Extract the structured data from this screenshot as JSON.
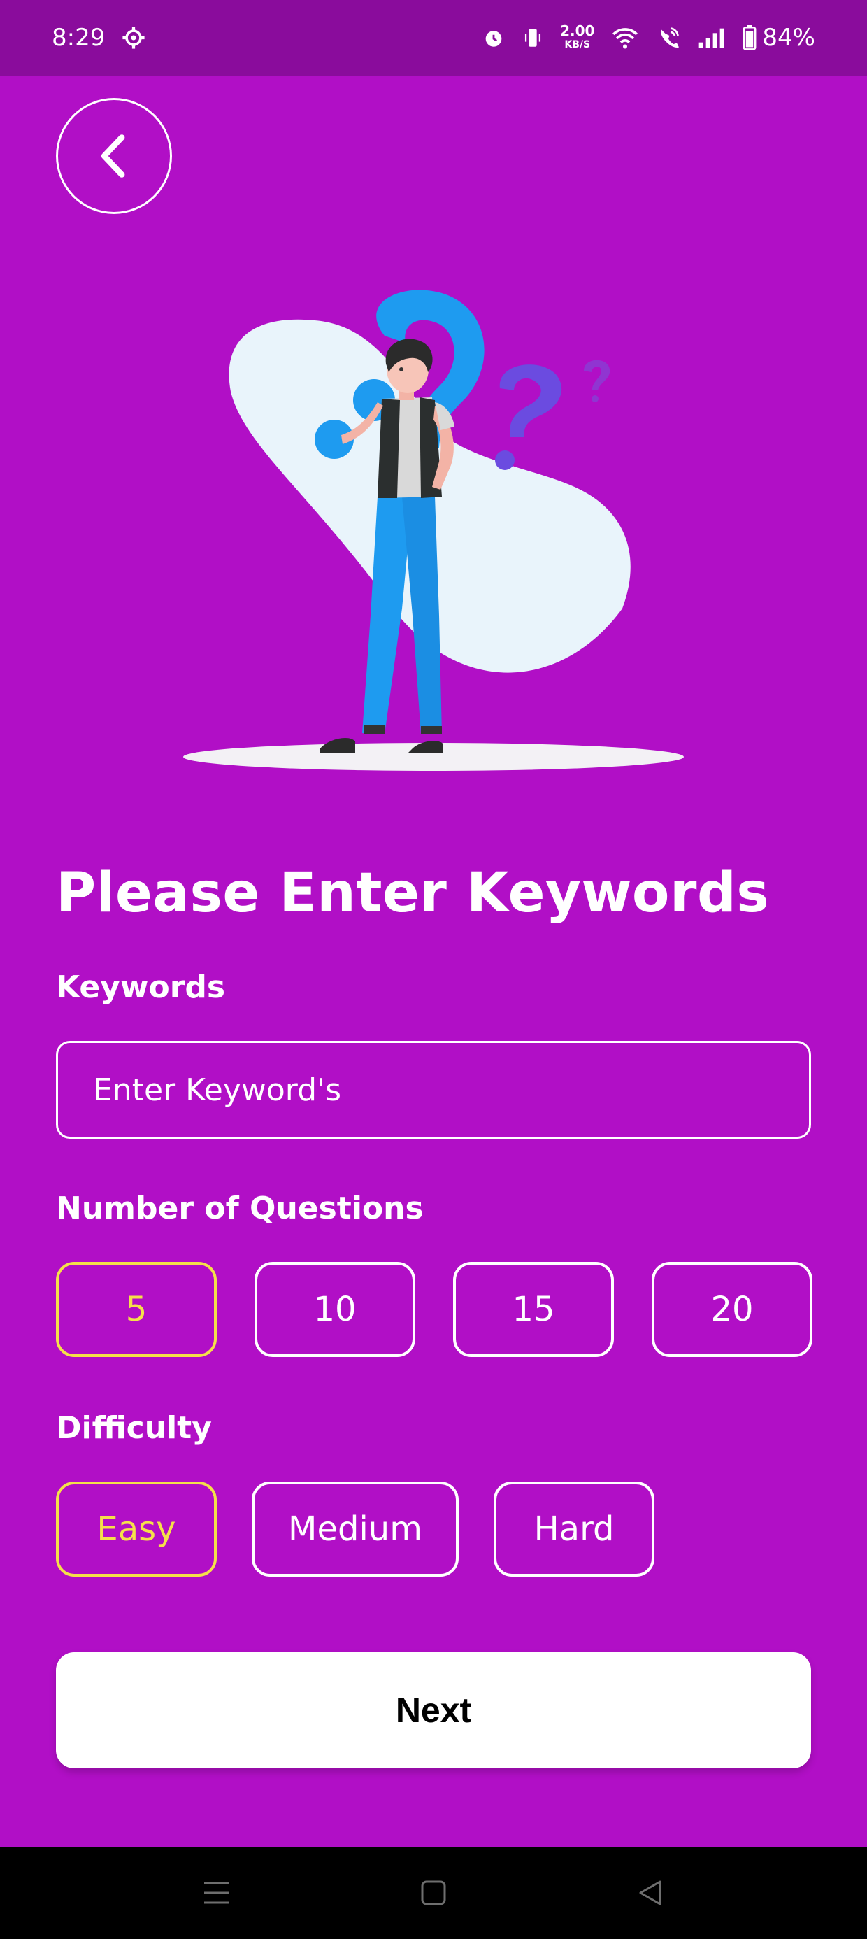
{
  "status_bar": {
    "time": "8:29",
    "net_speed_value": "2.00",
    "net_speed_unit": "KB/S",
    "battery": "84%",
    "icons": [
      "settings-icon",
      "alarm-icon",
      "vibrate-icon",
      "wifi-icon",
      "wifi-calling-icon",
      "signal-icon",
      "battery-icon"
    ]
  },
  "header": {
    "back_icon": "chevron-left-icon"
  },
  "main": {
    "title": "Please Enter Keywords",
    "keywords": {
      "label": "Keywords",
      "placeholder": "Enter Keyword's",
      "value": ""
    },
    "questions": {
      "label": "Number of Questions",
      "options": [
        "5",
        "10",
        "15",
        "20"
      ],
      "selected": "5"
    },
    "difficulty": {
      "label": "Difficulty",
      "options": [
        "Easy",
        "Medium",
        "Hard"
      ],
      "selected": "Easy"
    },
    "next_label": "Next"
  },
  "nav_bar": {
    "icons": [
      "menu-icon",
      "home-icon",
      "back-icon"
    ]
  },
  "colors": {
    "background": "#b10fc6",
    "status_bar": "#8a0c9c",
    "selected_accent": "#f5e04a",
    "illustration_blue": "#1e9bf0",
    "blob": "#e9f4fb"
  }
}
